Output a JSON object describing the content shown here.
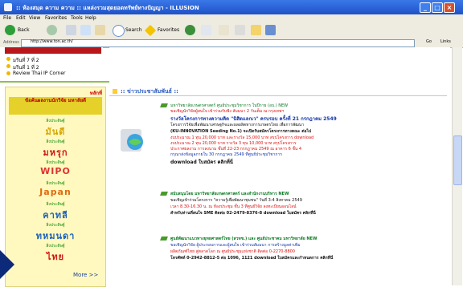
{
  "window": {
    "title": ":: ห้องสมุด ความ ความ :: แหล่งรวมสุดยอดทรัพย์ทางปัญญา - ILLUSION",
    "controls": [
      "_",
      "□",
      "×"
    ]
  },
  "menu": [
    "File",
    "Edit",
    "View",
    "Favorites",
    "Tools",
    "Help"
  ],
  "toolbar": {
    "back": "Back",
    "search": "Search",
    "favorites": "Favorites"
  },
  "address": {
    "label": "Address",
    "url": "http://www.ton.ac.th/",
    "go": "Go",
    "links": "Links"
  },
  "sidebar_links": [
    "มรีนที่ 7 ที่ 2",
    "มรีนที่ 1 ที่ 2",
    "Review Thai IP Corner"
  ],
  "left_panel": {
    "header": "หลักที่",
    "subheader": "ข้อค้นผลงานนักวิจัย มหาลัยดี",
    "categories": [
      {
        "small": "สิ่งประดิษฐ์",
        "big": "มันดี",
        "color": "#d8a400"
      },
      {
        "small": "สิ่งประดิษฐ์",
        "big": "มหรุก",
        "color": "#d11616"
      },
      {
        "small": "สิ่งประดิษฐ์",
        "big": "WIPO",
        "color": "#e03030"
      },
      {
        "small": "สิ่งประดิษฐ์",
        "big": "Japan",
        "color": "#e06a10"
      },
      {
        "small": "สิ่งประดิษฐ์",
        "big": "คาทลี",
        "color": "#1d5fb8"
      },
      {
        "small": "สิ่งประดิษฐ์",
        "big": "ทหมนดา",
        "color": "#1d5fb8"
      },
      {
        "small": "สิ่งประดิษฐ์",
        "big": "ไทย",
        "color": "#d11616"
      }
    ],
    "more": "More >>"
  },
  "main": {
    "section_title": ":: ข่าวประชาสัมพันธ์ ::",
    "news": [
      {
        "lines": [
          "มหาวิทยาลัยเกษตรศาสตร์ ศูนย์ประชุมวิชาการ ในปีกาย (อบ.) NEW",
          "ขอเชิญนักวิจัยผู้สนใจ เข้าร่วมรับฟัง สัมมนา 2 วันเต็ม ณ กรุงเทพฯ",
          "รางวัลโครงการทางความคิด \"นิสิตแลกเว\" ครบรอบ ครั้งที่ 21 กรกฎาคม 2549",
          "โครงการวิจัยเพื่อพัฒนาเศรษฐกิจและผลผลิตทางการเกษตรไทย เพื่อการพัฒนา",
          "(KU-INNOVATION Seeding No.1) จะเปิดรับสมัครโครงการทางคณะ ต่อไป",
          "งบประมาณ 1 ทุน 20,000 บาท และรางวัล 15,000 บาท สรุปโครงการ download",
          "งบประมาณ 2 ทุน 20,000 บาท รางวัล 3 ทุน 10,000 บาท สรุปโครงการ",
          "ประกาศผลงาน การลงนาม ชั้นที่ 22-23 กรกฎาคม 2549 ณ อาคาร 6 ชั้น 4",
          "กรุณาส่งข้อมูลภายใน 30 กรกฎาคม 2549 ที่ศูนย์ประชุมวิชาการ",
          "download ใบสมัคร คลิกที่นี่"
        ]
      },
      {
        "lines": [
          "สนับสนุนโดย มหาวิทยาลัยเกษตรศาสตร์ และสำนักงานบริหาร NEW",
          "ขอเชิญเข้าร่วมโครงการ \"ความรู้เพื่อพัฒนาชุมชน\" วันที่ 3-4 สิงหาคม 2549",
          "เวลา 8.30-16.30 น. ณ ห้องประชุม ชั้น 3 ที่ศูนย์วิจัย ลงทะเบียนออนไลน์",
          "สำหรับท่านที่สนใจ SME ติดต่อ 02-2479-8376-8 download ใบสมัคร คลิกที่นี่"
        ]
      },
      {
        "lines": [
          "ศูนย์พัฒนาแนวทางยุทธศาสตร์ไทย (สวทช.) และ ศูนย์ประชาคม มหาวิทยาลัย NEW",
          "ขอเชิญนักวิจัย ผู้ประกอบการและผู้สนใจ เข้าร่วมสัมมนา การสร้างมูลค่าเพิ่ม",
          "ผลิตภัณฑ์ไทย สู่ตลาดโลก ณ ศูนย์ประชุมแห่งชาติ ติดต่อ 0-2270-8800",
          "โทรศัพท์ 0-2942-8812-5 ต่อ 1096, 1121 download ใบสมัครและกำหนดการ คลิกที่นี่"
        ]
      }
    ]
  },
  "colors": {
    "titlebar": "#2a62d8",
    "accent_green": "#8fbf4f",
    "panel_bg": "#fff9bf",
    "link_blue": "#1336a8",
    "new_red": "#d11111"
  }
}
